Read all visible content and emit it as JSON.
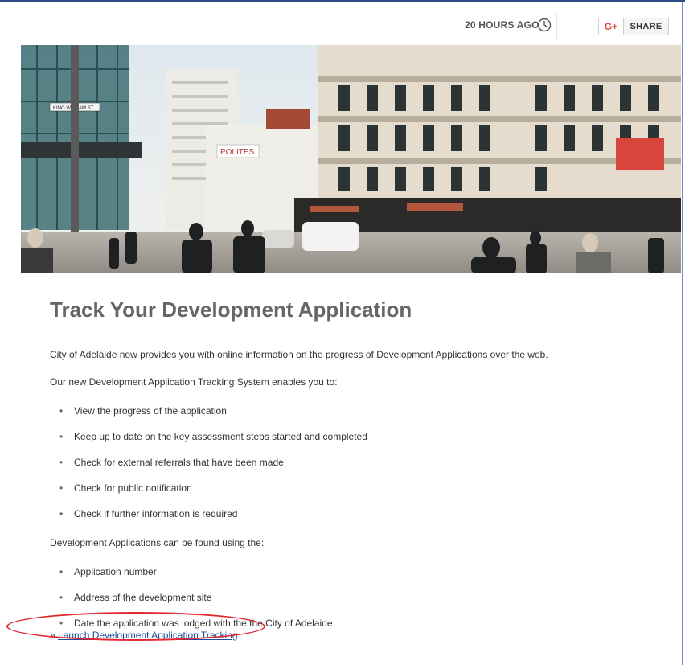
{
  "meta": {
    "time_ago": "20 HOURS AGO",
    "share": {
      "network_label": "G+",
      "label": "SHARE"
    }
  },
  "hero": {
    "image": "adelaide-street-scene",
    "sign_text": "POLITES",
    "street_sign": "KING WILLIAM ST"
  },
  "article": {
    "title": "Track Your Development Application",
    "intro": "City of Adelaide now provides you with online information on the progress of Development Applications over the web.",
    "enables_intro": "Our new Development Application Tracking System enables you to:",
    "enables_items": [
      "View the progress of the application",
      "Keep up to date on the key assessment steps started and completed",
      "Check for external referrals that have been made",
      "Check for public notification",
      "Check if further information is required"
    ],
    "search_intro": "Development Applications can be found using the:",
    "search_items": [
      "Application number",
      "Address of the development site",
      "Date the application was lodged with the the City of Adelaide"
    ],
    "launch_prefix": "»",
    "launch_link": "Launch Development Application Tracking"
  },
  "colors": {
    "highlight_ellipse": "#e3262f",
    "link": "#1a4ea0",
    "title": "#666666"
  }
}
